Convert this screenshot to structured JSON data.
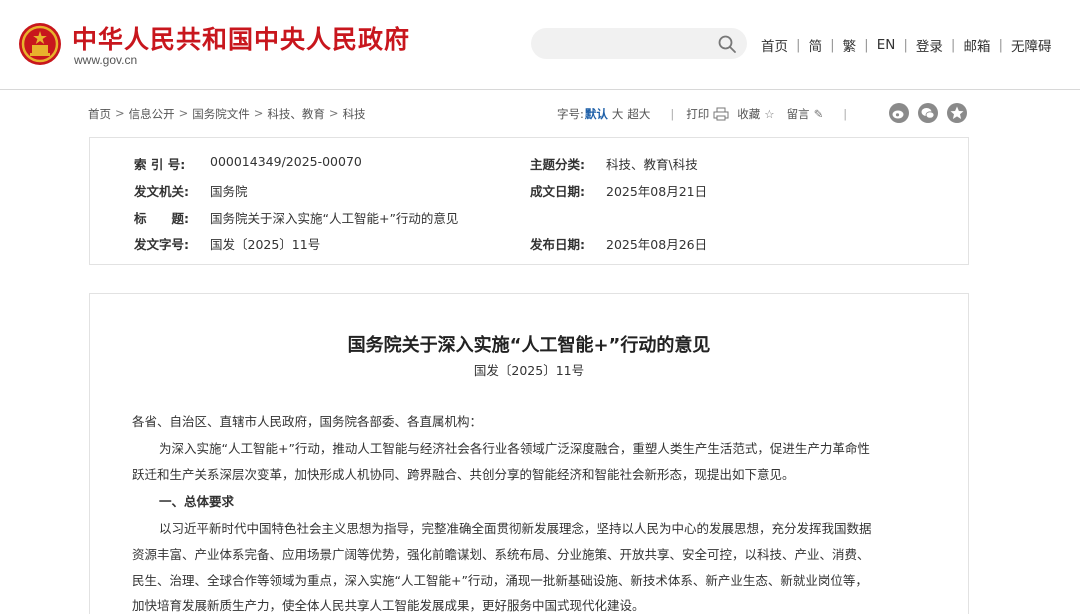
{
  "header": {
    "site_name": "中华人民共和国中央人民政府",
    "site_url": "www.gov.cn",
    "search_placeholder": "",
    "nav": [
      "首页",
      "简",
      "繁",
      "EN",
      "登录",
      "邮箱",
      "无障碍"
    ]
  },
  "breadcrumb": {
    "items": [
      "首页",
      "信息公开",
      "国务院文件",
      "科技、教育",
      "科技"
    ]
  },
  "tools": {
    "font_label": "字号:",
    "font_default": "默认",
    "font_large": "大",
    "font_xlarge": "超大",
    "print": "打印",
    "favorite": "收藏",
    "comment": "留言"
  },
  "meta": {
    "index_no_label": "索 引 号:",
    "index_no": "000014349/2025-00070",
    "category_label": "主题分类:",
    "category": "科技、教育\\科技",
    "issuer_label": "发文机关:",
    "issuer": "国务院",
    "written_date_label": "成文日期:",
    "written_date": "2025年08月21日",
    "title_label": "标　　题:",
    "title": "国务院关于深入实施“人工智能+”行动的意见",
    "doc_no_label": "发文字号:",
    "doc_no": "国发〔2025〕11号",
    "publish_date_label": "发布日期:",
    "publish_date": "2025年08月26日"
  },
  "article": {
    "title": "国务院关于深入实施“人工智能+”行动的意见",
    "doc_no": "国发〔2025〕11号",
    "salutation": "各省、自治区、直辖市人民政府，国务院各部委、各直属机构：",
    "intro_1": "为深入实施“人工智能+”行动，推动人工智能与经济社会各行业各领域广泛深度融合，重塑人类生产生活范式，促进生产力革命性",
    "intro_2": "跃迁和生产关系深层次变革，加快形成人机协同、跨界融合、共创分享的智能经济和智能社会新形态，现提出如下意见。",
    "section_1": "一、总体要求",
    "body_1": "以习近平新时代中国特色社会主义思想为指导，完整准确全面贯彻新发展理念，坚持以人民为中心的发展思想，充分发挥我国数据",
    "body_2": "资源丰富、产业体系完备、应用场景广阔等优势，强化前瞻谋划、系统布局、分业施策、开放共享、安全可控，以科技、产业、消费、",
    "body_3": "民生、治理、全球合作等领域为重点，深入实施“人工智能+”行动，涌现一批新基础设施、新技术体系、新产业生态、新就业岗位等，",
    "body_4": "加快培育发展新质生产力，使全体人民共享人工智能发展成果，更好服务中国式现代化建设。"
  },
  "colors": {
    "brand_red": "#c8161d",
    "link_blue": "#1d5fa8",
    "emblem_gold": "#e8b22c"
  }
}
